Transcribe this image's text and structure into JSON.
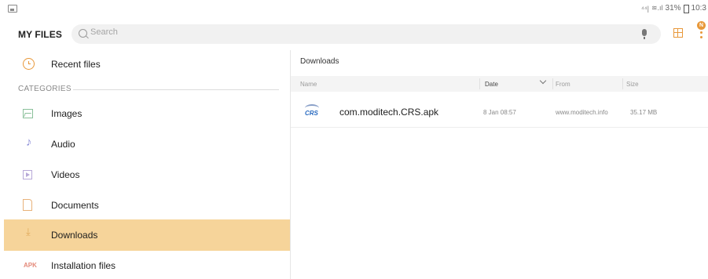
{
  "status_bar": {
    "signal_text": "⁴⁴|",
    "wifi_text": "≋.ıl",
    "battery_text": "31%",
    "time_text": "10:3"
  },
  "app_bar": {
    "title": "MY FILES",
    "search_placeholder": "Search",
    "notification_badge": "N"
  },
  "sidebar": {
    "recent_label": "Recent files",
    "categories_label": "CATEGORIES",
    "items": [
      {
        "label": "Images",
        "icon": "image-icon"
      },
      {
        "label": "Audio",
        "icon": "music-note-icon"
      },
      {
        "label": "Videos",
        "icon": "video-icon"
      },
      {
        "label": "Documents",
        "icon": "document-icon"
      },
      {
        "label": "Downloads",
        "icon": "download-icon",
        "active": true
      },
      {
        "label": "Installation files",
        "icon": "apk-icon",
        "icon_text": "APK"
      }
    ]
  },
  "main": {
    "breadcrumb": "Downloads",
    "columns": {
      "name": "Name",
      "date": "Date",
      "from": "From",
      "size": "Size"
    },
    "files": [
      {
        "name": "com.moditech.CRS.apk",
        "date": "8 Jan 08:57",
        "from": "www.moditech.info",
        "size": "35.17 MB",
        "icon_text": "CRS"
      }
    ]
  },
  "colors": {
    "accent": "#e8983a",
    "active_row": "#f6d49a",
    "header_bg": "#f4f4f4"
  }
}
